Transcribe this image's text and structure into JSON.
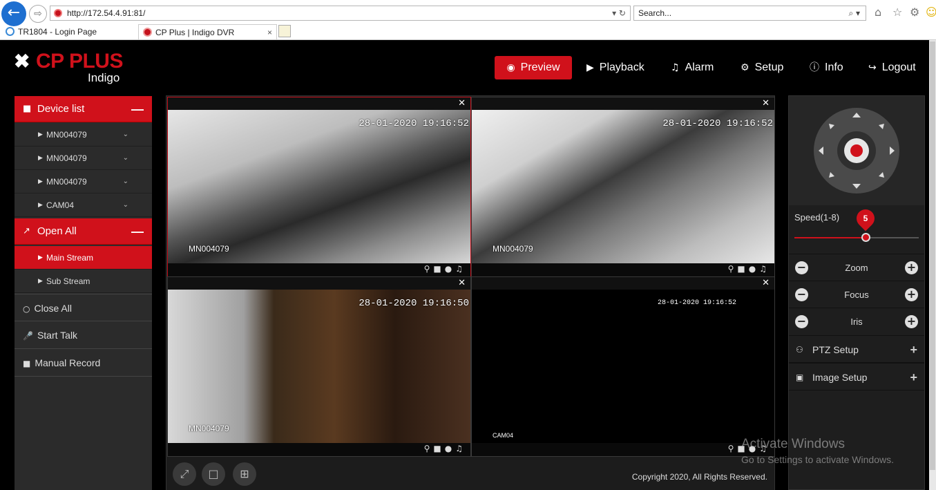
{
  "browser": {
    "back_icon": "back-arrow-icon",
    "address": "http://172.54.4.91:81/",
    "address_controls": "▾ ↻",
    "search_placeholder": "Search...",
    "search_controls": "⌕ ▾",
    "tabs": [
      {
        "label": "TR1804 - Login Page"
      },
      {
        "label": "CP Plus | Indigo DVR",
        "close": "×"
      }
    ]
  },
  "app": {
    "brand": "CP PLUS",
    "subbrand": "Indigo",
    "accent_color": "#d0111b",
    "nav": [
      {
        "label": "Preview",
        "icon": "eye-icon"
      },
      {
        "label": "Playback",
        "icon": "play-circle-icon"
      },
      {
        "label": "Alarm",
        "icon": "bell-icon"
      },
      {
        "label": "Setup",
        "icon": "gear-icon"
      },
      {
        "label": "Info",
        "icon": "info-icon"
      },
      {
        "label": "Logout",
        "icon": "logout-icon"
      }
    ]
  },
  "sidebar": {
    "device_list_label": "Device list",
    "devices": [
      {
        "label": "MN004079"
      },
      {
        "label": "MN004079"
      },
      {
        "label": "MN004079"
      },
      {
        "label": "CAM04"
      }
    ],
    "open_all_label": "Open All",
    "streams": [
      {
        "label": "Main Stream",
        "active": true
      },
      {
        "label": "Sub Stream",
        "active": false
      }
    ],
    "close_all_label": "Close All",
    "start_talk_label": "Start Talk",
    "manual_record_label": "Manual Record"
  },
  "cameras": [
    {
      "name": "MN004079",
      "timestamp": "28-01-2020 19:16:52",
      "selected": true
    },
    {
      "name": "MN004079",
      "timestamp": "28-01-2020 19:16:52",
      "selected": false
    },
    {
      "name": "MN004079",
      "timestamp": "28-01-2020 19:16:50",
      "selected": false
    },
    {
      "name": "CAM04",
      "timestamp": "28-01-2020 19:16:52",
      "selected": false
    }
  ],
  "footer": {
    "copyright": "Copyright 2020, All Rights Reserved."
  },
  "ptz": {
    "speed_label": "Speed(1-8)",
    "speed_value": "5",
    "speed_min": 1,
    "speed_max": 8,
    "controls": [
      {
        "label": "Zoom"
      },
      {
        "label": "Focus"
      },
      {
        "label": "Iris"
      }
    ],
    "ptz_setup_label": "PTZ Setup",
    "image_setup_label": "Image Setup"
  },
  "watermark": {
    "line1": "Activate Windows",
    "line2": "Go to Settings to activate Windows."
  }
}
